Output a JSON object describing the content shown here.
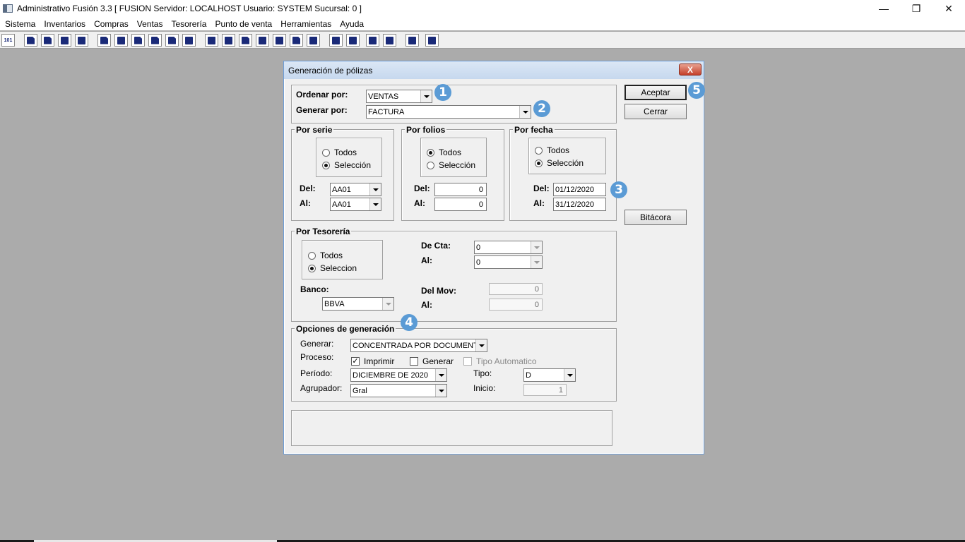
{
  "window": {
    "title": "Administrativo Fusión 3.3 [ FUSION   Servidor: LOCALHOST   Usuario: SYSTEM    Sucursal: 0 ]",
    "minimize": "—",
    "maximize": "❐",
    "close": "✕"
  },
  "menu": [
    "Sistema",
    "Inventarios",
    "Compras",
    "Ventas",
    "Tesorería",
    "Punto de venta",
    "Herramientas",
    "Ayuda"
  ],
  "toolbar_first_label": "101",
  "dialog": {
    "title": "Generación de pólizas",
    "close_label": "X",
    "ordenar_label": "Ordenar por:",
    "ordenar_value": "VENTAS",
    "generar_por_label": "Generar por:",
    "generar_por_value": "FACTURA",
    "serie": {
      "legend": "Por serie",
      "todos": "Todos",
      "seleccion": "Selección",
      "del_label": "Del:",
      "al_label": "Al:",
      "del_value": "AA01",
      "al_value": "AA01"
    },
    "folios": {
      "legend": "Por folios",
      "todos": "Todos",
      "seleccion": "Selección",
      "del_label": "Del:",
      "al_label": "Al:",
      "del_value": "0",
      "al_value": "0"
    },
    "fecha": {
      "legend": "Por fecha",
      "todos": "Todos",
      "seleccion": "Selección",
      "del_label": "Del:",
      "al_label": "Al:",
      "del_value": "01/12/2020",
      "al_value": "31/12/2020"
    },
    "tesoreria": {
      "legend": "Por Tesorería",
      "todos": "Todos",
      "seleccion": "Seleccion",
      "de_cta_label": "De Cta:",
      "al_cta_label": "Al:",
      "de_cta_value": "0",
      "al_cta_value": "0",
      "banco_label": "Banco:",
      "banco_value": "BBVA",
      "del_mov_label": "Del Mov:",
      "al_mov_label": "Al:",
      "del_mov_value": "0",
      "al_mov_value": "0"
    },
    "opciones": {
      "legend": "Opciones de generación",
      "generar_label": "Generar:",
      "generar_value": "CONCENTRADA POR DOCUMENTO",
      "proceso_label": "Proceso:",
      "imprimir": "Imprimir",
      "generar_chk": "Generar",
      "tipo_auto": "Tipo Automatico",
      "periodo_label": "Período:",
      "periodo_value": "DICIEMBRE DE 2020",
      "tipo_label": "Tipo:",
      "tipo_value": "D",
      "agrupador_label": "Agrupador:",
      "agrupador_value": "Gral",
      "inicio_label": "Inicio:",
      "inicio_value": "1"
    },
    "buttons": {
      "aceptar": "Aceptar",
      "cerrar": "Cerrar",
      "bitacora": "Bitácora"
    },
    "badges": [
      "1",
      "2",
      "3",
      "4",
      "5"
    ]
  },
  "colors": {
    "desktop": "#ababab",
    "badge": "#5b9bd5",
    "dialog_border": "#6f9fd8"
  }
}
